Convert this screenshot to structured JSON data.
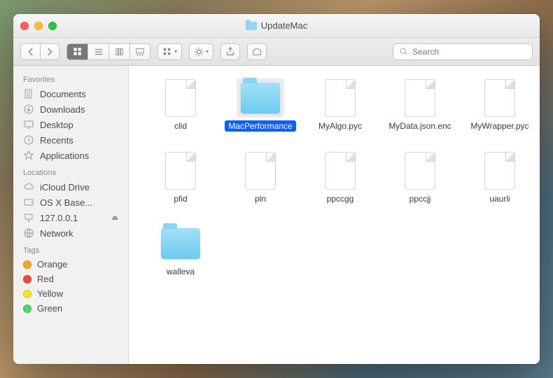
{
  "window": {
    "title": "UpdateMac"
  },
  "search": {
    "placeholder": "Search"
  },
  "sidebar": {
    "sections": {
      "favorites": {
        "header": "Favorites",
        "items": [
          "Documents",
          "Downloads",
          "Desktop",
          "Recents",
          "Applications"
        ]
      },
      "locations": {
        "header": "Locations",
        "items": [
          "iCloud Drive",
          "OS X Base...",
          "127.0.0.1",
          "Network"
        ]
      },
      "tags": {
        "header": "Tags",
        "items": [
          {
            "label": "Orange",
            "color": "#f5a623"
          },
          {
            "label": "Red",
            "color": "#e94b3c"
          },
          {
            "label": "Yellow",
            "color": "#f8e71c"
          },
          {
            "label": "Green",
            "color": "#4cd964"
          }
        ]
      }
    }
  },
  "files": [
    {
      "name": "clid",
      "type": "file",
      "selected": false
    },
    {
      "name": "MacPerformance",
      "type": "folder",
      "selected": true
    },
    {
      "name": "MyAlgo.pyc",
      "type": "file",
      "selected": false
    },
    {
      "name": "MyData.json.enc",
      "type": "file",
      "selected": false
    },
    {
      "name": "MyWrapper.pyc",
      "type": "file",
      "selected": false
    },
    {
      "name": "pfid",
      "type": "file",
      "selected": false
    },
    {
      "name": "pln",
      "type": "file",
      "selected": false
    },
    {
      "name": "ppccgg",
      "type": "file",
      "selected": false
    },
    {
      "name": "ppccjj",
      "type": "file",
      "selected": false
    },
    {
      "name": "uaurli",
      "type": "file",
      "selected": false
    },
    {
      "name": "walleva",
      "type": "folder",
      "selected": false
    }
  ]
}
